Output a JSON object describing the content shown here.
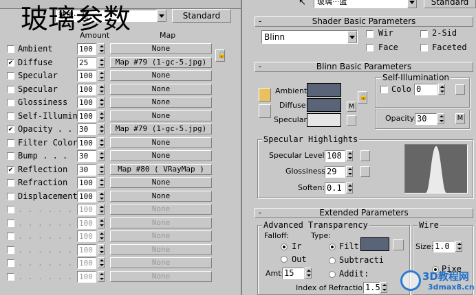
{
  "overlay_title": "玻璃参数",
  "left_panel": {
    "material_name": "玻璃···蓝",
    "type_button": "Standard",
    "header_amount": "Amount",
    "header_map": "Map",
    "rows": [
      {
        "checked": false,
        "label": "Ambient",
        "amount": "100",
        "map": "None",
        "enabled": true,
        "has_lock": true
      },
      {
        "checked": true,
        "label": "Diffuse",
        "amount": "25",
        "map": "Map #79 (1-gc-5.jpg)",
        "enabled": true
      },
      {
        "checked": false,
        "label": "Specular",
        "amount": "100",
        "map": "None",
        "enabled": true
      },
      {
        "checked": false,
        "label": "Specular",
        "amount": "100",
        "map": "None",
        "enabled": true
      },
      {
        "checked": false,
        "label": "Glossiness",
        "amount": "100",
        "map": "None",
        "enabled": true
      },
      {
        "checked": false,
        "label": "Self-Illumin",
        "amount": "100",
        "map": "None",
        "enabled": true
      },
      {
        "checked": true,
        "label": "Opacity . .",
        "amount": "30",
        "map": "Map #79 (1-gc-5.jpg)",
        "enabled": true
      },
      {
        "checked": false,
        "label": "Filter Color",
        "amount": "100",
        "map": "None",
        "enabled": true
      },
      {
        "checked": false,
        "label": "Bump . . .",
        "amount": "30",
        "map": "None",
        "enabled": true
      },
      {
        "checked": true,
        "label": "Reflection",
        "amount": "30",
        "map": "Map #80  ( VRayMap )",
        "enabled": true
      },
      {
        "checked": false,
        "label": "Refraction",
        "amount": "100",
        "map": "None",
        "enabled": true
      },
      {
        "checked": false,
        "label": "Displacement",
        "amount": "100",
        "map": "None",
        "enabled": true
      },
      {
        "checked": false,
        "label": ". . . . . .",
        "amount": "100",
        "map": "None",
        "enabled": false
      },
      {
        "checked": false,
        "label": ". . . . . .",
        "amount": "100",
        "map": "None",
        "enabled": false
      },
      {
        "checked": false,
        "label": ". . . . . .",
        "amount": "100",
        "map": "None",
        "enabled": false
      },
      {
        "checked": false,
        "label": ". . . . . .",
        "amount": "100",
        "map": "None",
        "enabled": false
      },
      {
        "checked": false,
        "label": ". . . . . .",
        "amount": "100",
        "map": "None",
        "enabled": false
      },
      {
        "checked": false,
        "label": ". . . . . .",
        "amount": "100",
        "map": "None",
        "enabled": false
      }
    ]
  },
  "right_panel": {
    "material_name": "玻璃···蓝",
    "type_button": "Standard",
    "shader_basic": {
      "title": "Shader Basic Parameters",
      "shader": "Blinn",
      "wire": "Wir",
      "two_sided": "2-Sid",
      "face": "Face",
      "faceted": "Faceted"
    },
    "blinn_basic": {
      "title": "Blinn Basic Parameters",
      "self_illum_title": "Self-Illumination",
      "ambient_label": "Ambient:",
      "diffuse_label": "Diffuse:",
      "specular_label": "Specular:",
      "color_label": "Colo",
      "color_value": "0",
      "opacity_label": "Opacity:",
      "opacity_value": "30",
      "m_label": "M",
      "ambient_color": "#5a6478",
      "diffuse_color": "#5a6478",
      "specular_color": "#e6e6e6"
    },
    "specular_highlights": {
      "title": "Specular Highlights",
      "level_label": "Specular Level:",
      "level_value": "108",
      "gloss_label": "Glossiness:",
      "gloss_value": "29",
      "soften_label": "Soften:",
      "soften_value": "0.1"
    },
    "extended": {
      "title": "Extended Parameters",
      "adv_title": "Advanced Transparency",
      "falloff_label": "Falloff:",
      "type_label": "Type:",
      "in_label": "Ir",
      "out_label": "Out",
      "filter_label": "Filt",
      "subtractive_label": "Subtracti",
      "additive_label": "Addit:",
      "amt_label": "Amt:",
      "amt_value": "15",
      "ior_label": "Index of Refraction:",
      "ior_value": "1.5",
      "wire_title": "Wire",
      "size_label": "Size:",
      "size_value": "1.0",
      "pixels_label": "Pixe",
      "filter_color": "#5a6478"
    }
  },
  "watermark": {
    "logo_text": "3D教程网",
    "url_text": "3dmax8.cn"
  }
}
